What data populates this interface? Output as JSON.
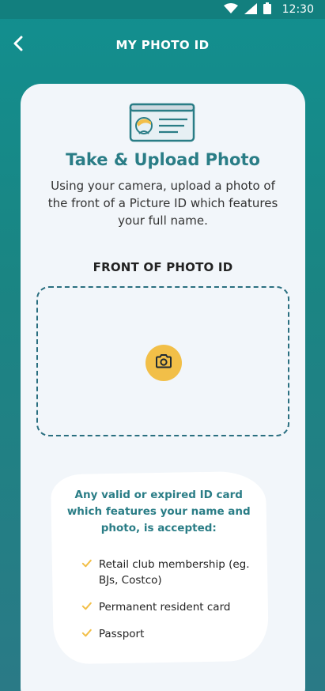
{
  "status_bar": {
    "time": "12:30",
    "icons": [
      "wifi-icon",
      "signal-icon",
      "battery-icon"
    ]
  },
  "header": {
    "title": "MY PHOTO ID",
    "back_icon": "chevron-left-icon"
  },
  "card": {
    "illustration_icon": "id-card-icon",
    "title": "Take & Upload Photo",
    "description": "Using your camera, upload a photo of the front of a Picture ID which features your full name.",
    "upload_label": "FRONT OF PHOTO ID",
    "camera_icon": "camera-icon"
  },
  "accepted": {
    "title": "Any valid or expired ID card which features your name and photo, is accepted:",
    "items": [
      "Retail club membership (eg. BJs, Costco)",
      "Permanent resident card",
      "Passport"
    ]
  },
  "colors": {
    "background": "#1a8583",
    "card": "#f2f6fa",
    "accent": "#2a7d86",
    "camera_button": "#f2bf48",
    "check": "#f2bf48"
  }
}
